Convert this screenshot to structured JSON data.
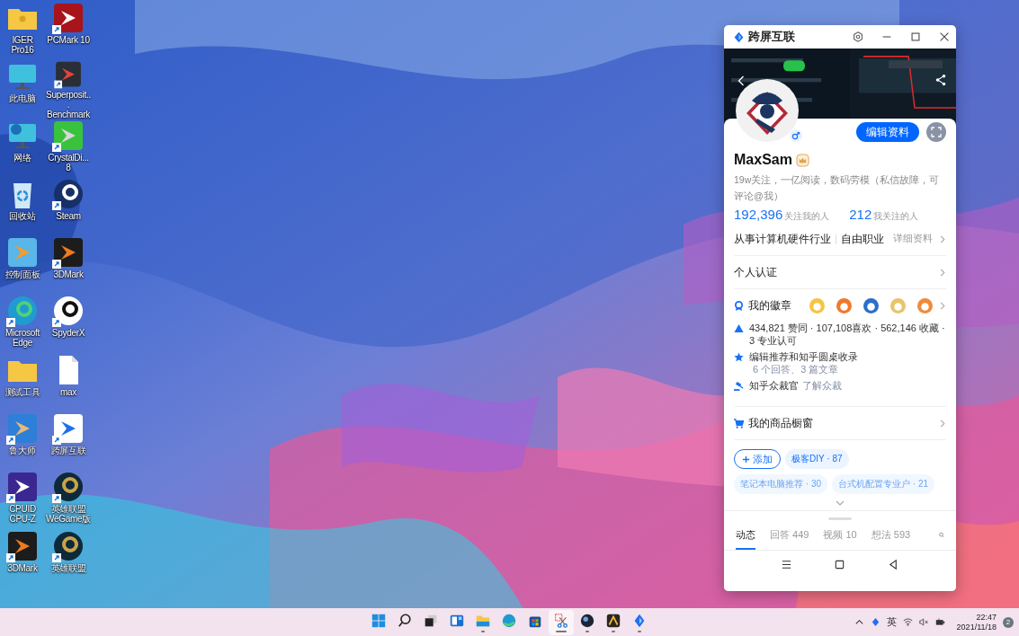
{
  "desktop_icons": [
    {
      "label": "IGER Pro16",
      "kind": "user-folder",
      "shortcut": false
    },
    {
      "label": "PCMark 10",
      "kind": "pcmark",
      "shortcut": true
    },
    {
      "label": "此电脑",
      "kind": "pc",
      "shortcut": false
    },
    {
      "label": "Superposit... Benchmark",
      "kind": "superposition",
      "shortcut": true
    },
    {
      "label": "网络",
      "kind": "network",
      "shortcut": false
    },
    {
      "label": "CrystalDi... 8",
      "kind": "crystaldisk",
      "shortcut": true
    },
    {
      "label": "回收站",
      "kind": "recycle",
      "shortcut": false
    },
    {
      "label": "Steam",
      "kind": "steam",
      "shortcut": true
    },
    {
      "label": "控制面板",
      "kind": "control",
      "shortcut": false
    },
    {
      "label": "3DMark",
      "kind": "futuremark",
      "shortcut": true
    },
    {
      "label": "Microsoft Edge",
      "kind": "edge",
      "shortcut": true
    },
    {
      "label": "SpyderX",
      "kind": "spyder",
      "shortcut": true
    },
    {
      "label": "测试工具",
      "kind": "folder",
      "shortcut": false
    },
    {
      "label": "max",
      "kind": "file",
      "shortcut": false
    },
    {
      "label": "鲁大师",
      "kind": "ludashi",
      "shortcut": true
    },
    {
      "label": "跨屏互联",
      "kind": "kuaping",
      "shortcut": true
    },
    {
      "label": "CPUID CPU-Z",
      "kind": "cpuz",
      "shortcut": true
    },
    {
      "label": "英雄联盟 WeGame版",
      "kind": "lol",
      "shortcut": true
    },
    {
      "label": "3DMark",
      "kind": "futuremark",
      "shortcut": true
    },
    {
      "label": "英雄联盟",
      "kind": "lol",
      "shortcut": true
    }
  ],
  "window": {
    "title": "跨屏互联"
  },
  "profile": {
    "name": "MaxSam",
    "edit_button": "编辑资料",
    "bio": "19w关注，一亿阅读，数码劳模（私信故障，可评论@我）",
    "stats": [
      {
        "value": "192,396",
        "label": "关注我的人"
      },
      {
        "value": "212",
        "label": "我关注的人"
      }
    ]
  },
  "occupation": {
    "industry": "从事计算机硬件行业",
    "job": "自由职业",
    "link": "详细资料"
  },
  "certification": "个人认证",
  "badges": {
    "label": "我的徽章",
    "items": [
      {
        "color": "#f5c542"
      },
      {
        "color": "#f07a2a"
      },
      {
        "color": "#2a6fc9"
      },
      {
        "color": "#e8c46a"
      },
      {
        "color": "#f08a3a"
      }
    ]
  },
  "achievements": [
    {
      "kind": "likes",
      "text": "434,821 赞同 · 107,108喜欢 · 562,146 收藏 · 3 专业认可"
    },
    {
      "kind": "star",
      "text": "编辑推荐和知乎圆桌收录",
      "link": "6 个回答、3 篇文章"
    },
    {
      "kind": "judge",
      "text": "知乎众裁官",
      "link": "了解众裁"
    }
  ],
  "shop": "我的商品橱窗",
  "topics": {
    "add": "添加",
    "tags": [
      "极客DIY · 87",
      "笔记本电脑推荐 · 30",
      "台式机配置专业户 · 21"
    ]
  },
  "tabs": [
    {
      "label": "动态",
      "selected": true
    },
    {
      "label": "回答 449",
      "selected": false
    },
    {
      "label": "视频 10",
      "selected": false
    },
    {
      "label": "想法 593",
      "selected": false
    }
  ],
  "taskbar": [
    {
      "kind": "start",
      "running": false,
      "selected": false
    },
    {
      "kind": "search",
      "running": false,
      "selected": false
    },
    {
      "kind": "taskview",
      "running": false,
      "selected": false
    },
    {
      "kind": "widgets",
      "running": false,
      "selected": false
    },
    {
      "kind": "explorer",
      "running": true,
      "selected": false
    },
    {
      "kind": "edge",
      "running": false,
      "selected": false
    },
    {
      "kind": "store",
      "running": false,
      "selected": false
    },
    {
      "kind": "snip",
      "running": true,
      "selected": true
    },
    {
      "kind": "cinema",
      "running": true,
      "selected": false
    },
    {
      "kind": "app",
      "running": true,
      "selected": false
    },
    {
      "kind": "kuaping",
      "running": true,
      "selected": false
    }
  ],
  "tray": {
    "input": "英",
    "time": "22:47",
    "date": "2021/11/18",
    "notifications": "2"
  }
}
